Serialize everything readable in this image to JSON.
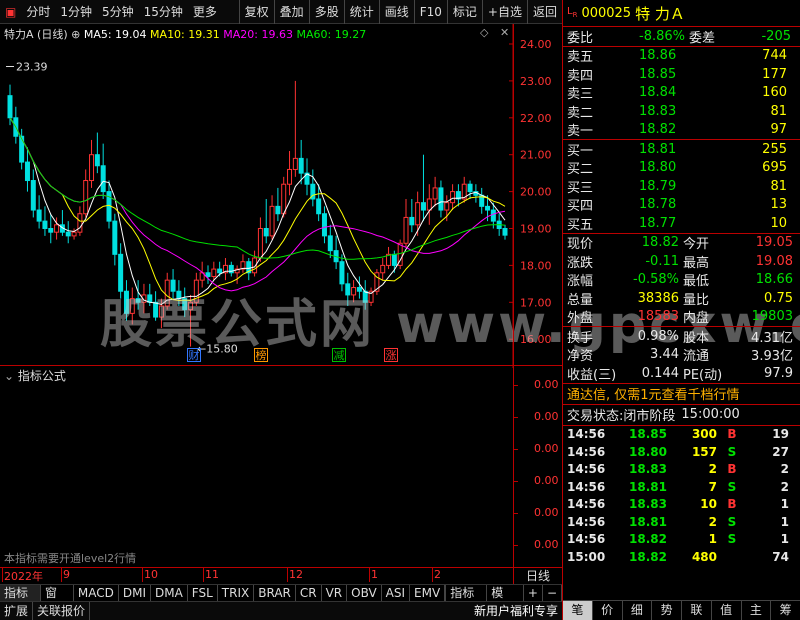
{
  "toolbar": {
    "left": [
      "分时",
      "1分钟",
      "5分钟",
      "15分钟",
      "更多"
    ],
    "right": [
      "复权",
      "叠加",
      "多股",
      "统计",
      "画线",
      "F10",
      "标记",
      "+自选",
      "返回"
    ]
  },
  "legend": {
    "name": "特力A (日线)",
    "ma5": "MA5: 19.04",
    "ma10": "MA10: 19.31",
    "ma20": "MA20: 19.63",
    "ma60": "MA60: 19.27",
    "colors": {
      "ma5": "#ffffff",
      "ma10": "#ffff00",
      "ma20": "#ff00ff",
      "ma60": "#00e000"
    }
  },
  "price_axis": [
    "24.00",
    "23.00",
    "22.00",
    "21.00",
    "20.00",
    "19.00",
    "18.00",
    "17.00",
    "16.00"
  ],
  "high_label": "23.39",
  "low_label": "←15.80",
  "event_tags": [
    {
      "text": "财",
      "color": "#3377ff"
    },
    {
      "text": "榜",
      "color": "#ff9900"
    },
    {
      "text": "减",
      "color": "#00c000"
    },
    {
      "text": "涨",
      "color": "#ff3333"
    }
  ],
  "indicator": {
    "title": "指标公式",
    "axis": [
      "0.00",
      "0.00",
      "0.00",
      "0.00",
      "0.00",
      "0.00"
    ],
    "note": "本指标需要开通level2行情"
  },
  "date_axis": [
    "2022年",
    "9",
    "10",
    "11",
    "12",
    "1",
    "2"
  ],
  "date_right": "日线",
  "bottom_tabs": [
    "指标A",
    "窗口",
    "MACD",
    "DMI",
    "DMA",
    "FSL",
    "TRIX",
    "BRAR",
    "CR",
    "VR",
    "OBV",
    "ASI",
    "EMV",
    "指标B",
    "模 板",
    "+",
    "−"
  ],
  "status_bar": {
    "left": [
      "扩展",
      "关联报价"
    ],
    "promo": "新用户福利专享"
  },
  "quote": {
    "code": "000025",
    "name": "特 力Ａ",
    "webi_label": "委比",
    "webi": "-8.86%",
    "weicha_label": "委差",
    "weicha": "-205",
    "asks": [
      {
        "label": "卖五",
        "price": "18.86",
        "vol": "744"
      },
      {
        "label": "卖四",
        "price": "18.85",
        "vol": "177"
      },
      {
        "label": "卖三",
        "price": "18.84",
        "vol": "160"
      },
      {
        "label": "卖二",
        "price": "18.83",
        "vol": "81"
      },
      {
        "label": "卖一",
        "price": "18.82",
        "vol": "97"
      }
    ],
    "bids": [
      {
        "label": "买一",
        "price": "18.81",
        "vol": "255"
      },
      {
        "label": "买二",
        "price": "18.80",
        "vol": "695"
      },
      {
        "label": "买三",
        "price": "18.79",
        "vol": "81"
      },
      {
        "label": "买四",
        "price": "18.78",
        "vol": "13"
      },
      {
        "label": "买五",
        "price": "18.77",
        "vol": "10"
      }
    ],
    "stats": [
      {
        "l1": "现价",
        "v1": "18.82",
        "c1": "green",
        "l2": "今开",
        "v2": "19.05",
        "c2": "red"
      },
      {
        "l1": "涨跌",
        "v1": "-0.11",
        "c1": "green",
        "l2": "最高",
        "v2": "19.08",
        "c2": "red"
      },
      {
        "l1": "涨幅",
        "v1": "-0.58%",
        "c1": "green",
        "l2": "最低",
        "v2": "18.66",
        "c2": "green"
      },
      {
        "l1": "总量",
        "v1": "38386",
        "c1": "yellow",
        "l2": "量比",
        "v2": "0.75",
        "c2": "yellow"
      },
      {
        "l1": "外盘",
        "v1": "18583",
        "c1": "red",
        "l2": "内盘",
        "v2": "19803",
        "c2": "green"
      }
    ],
    "stats2": [
      {
        "l1": "换手",
        "v1": "0.98%",
        "l2": "股本",
        "v2": "4.31亿"
      },
      {
        "l1": "净资",
        "v1": "3.44",
        "l2": "流通",
        "v2": "3.93亿"
      },
      {
        "l1": "收益(三)",
        "v1": "0.144",
        "l2": "PE(动)",
        "v2": "97.9"
      }
    ],
    "promo": "通达信, 仅需1元查看千档行情",
    "trade_status_label": "交易状态:",
    "trade_status": "闭市阶段",
    "trade_time": "15:00:00",
    "ticks": [
      {
        "t": "14:56",
        "p": "18.85",
        "v": "300",
        "d": "B",
        "n": "19"
      },
      {
        "t": "14:56",
        "p": "18.80",
        "v": "157",
        "d": "S",
        "n": "27"
      },
      {
        "t": "14:56",
        "p": "18.83",
        "v": "2",
        "d": "B",
        "n": "2"
      },
      {
        "t": "14:56",
        "p": "18.81",
        "v": "7",
        "d": "S",
        "n": "2"
      },
      {
        "t": "14:56",
        "p": "18.83",
        "v": "10",
        "d": "B",
        "n": "1"
      },
      {
        "t": "14:56",
        "p": "18.81",
        "v": "2",
        "d": "S",
        "n": "1"
      },
      {
        "t": "14:56",
        "p": "18.82",
        "v": "1",
        "d": "S",
        "n": "1"
      },
      {
        "t": "15:00",
        "p": "18.82",
        "v": "480",
        "d": "",
        "n": "74"
      }
    ],
    "bottom_tabs": [
      "笔",
      "价",
      "细",
      "势",
      "联",
      "值",
      "主",
      "筹"
    ]
  },
  "watermark": "股票公式网 www.gpcxw.com"
}
